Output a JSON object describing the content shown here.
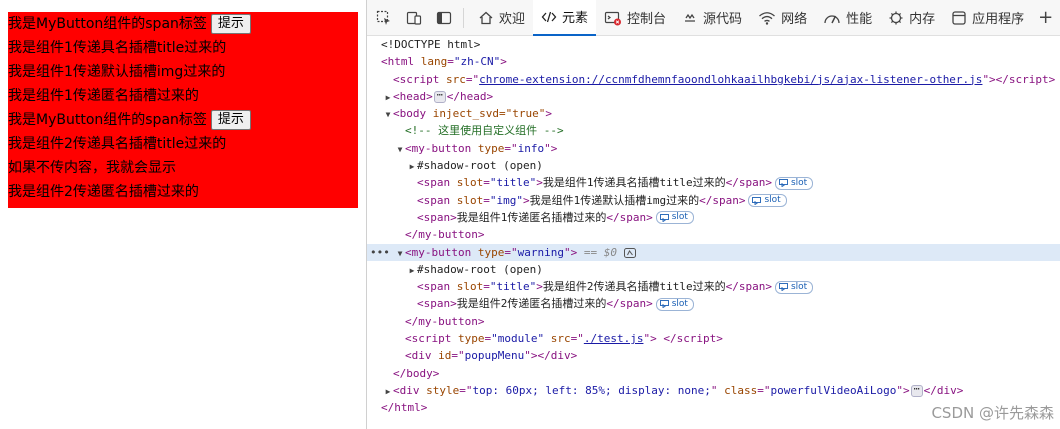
{
  "rendered": {
    "box_color": "#ff0000",
    "lines": [
      {
        "text": "我是MyButton组件的span标签",
        "button": "提示"
      },
      {
        "text": "我是组件1传递具名插槽title过来的"
      },
      {
        "text": "我是组件1传递默认插槽img过来的"
      },
      {
        "text": "我是组件1传递匿名插槽过来的"
      },
      {
        "text": "我是MyButton组件的span标签",
        "button": "提示"
      },
      {
        "text": "我是组件2传递具名插槽title过来的"
      },
      {
        "text": "如果不传内容，我就会显示"
      },
      {
        "text": "我是组件2传递匿名插槽过来的"
      }
    ]
  },
  "devtools": {
    "tabs": [
      {
        "label": "欢迎",
        "icon": "home-icon"
      },
      {
        "label": "元素",
        "icon": "code-icon",
        "active": true
      },
      {
        "label": "控制台",
        "icon": "console-icon"
      },
      {
        "label": "源代码",
        "icon": "sources-icon"
      },
      {
        "label": "网络",
        "icon": "wifi-icon"
      },
      {
        "label": "性能",
        "icon": "performance-icon"
      },
      {
        "label": "内存",
        "icon": "memory-icon"
      },
      {
        "label": "应用程序",
        "icon": "application-icon"
      }
    ],
    "overflow": "+",
    "tree": {
      "doctype": "<!DOCTYPE html>",
      "html_open": "<html lang=\"zh-CN\">",
      "script_src": "chrome-extension://ccnmfdhemnfaoondlohkaailhbgkebi/js/ajax-listener-other.js",
      "head": "head",
      "body_attr": "inject_svd=\"true\"",
      "comment": "<!-- 这里使用自定义组件 -->",
      "my_button_1_type": "info",
      "shadow_root": "#shadow-root (open)",
      "mb1_title_text": "我是组件1传递具名插槽title过来的",
      "mb1_img_text": "我是组件1传递默认插槽img过来的",
      "mb1_anon_text": "我是组件1传递匿名插槽过来的",
      "my_button_2_type": "warning",
      "selected_marker": "== $0",
      "mb2_title_text": "我是组件2传递具名插槽title过来的",
      "mb2_anon_text": "我是组件2传递匿名插槽过来的",
      "module_src": "./test.js",
      "popup_id": "popupMenu",
      "div_style": "top: 60px; left: 85%; display: none;",
      "div_class": "powerfulVideoAiLogo",
      "slot_label": "slot"
    }
  },
  "watermark": "CSDN @许先森森"
}
